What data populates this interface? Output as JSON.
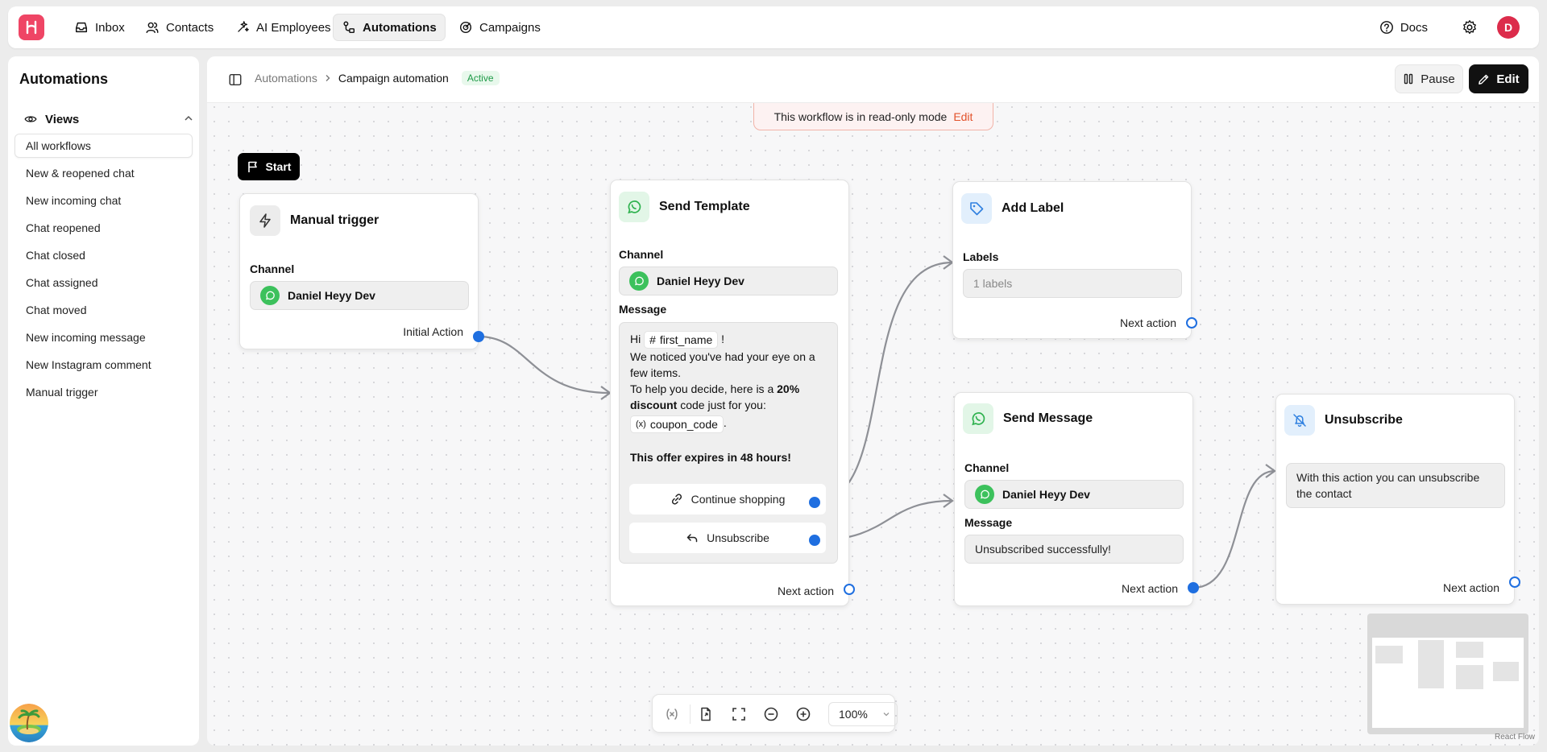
{
  "nav": {
    "items": [
      {
        "label": "Inbox",
        "icon": "inbox-icon"
      },
      {
        "label": "Contacts",
        "icon": "contacts-icon"
      },
      {
        "label": "AI Employees",
        "icon": "sparkle-icon"
      },
      {
        "label": "Automations",
        "icon": "automations-icon",
        "active": true
      },
      {
        "label": "Campaigns",
        "icon": "campaigns-icon"
      }
    ],
    "docs_label": "Docs",
    "avatar_initial": "D"
  },
  "sidebar": {
    "title": "Automations",
    "views_label": "Views",
    "items": [
      {
        "label": "All workflows",
        "active": true
      },
      {
        "label": "New & reopened chat"
      },
      {
        "label": "New incoming chat"
      },
      {
        "label": "Chat reopened"
      },
      {
        "label": "Chat closed"
      },
      {
        "label": "Chat assigned"
      },
      {
        "label": "Chat moved"
      },
      {
        "label": "New incoming message"
      },
      {
        "label": "New Instagram comment"
      },
      {
        "label": "Manual trigger"
      }
    ]
  },
  "header": {
    "breadcrumb_root": "Automations",
    "breadcrumb_current": "Campaign automation",
    "status": "Active",
    "pause_label": "Pause",
    "edit_label": "Edit"
  },
  "banner": {
    "text": "This workflow is in read-only mode",
    "link": "Edit"
  },
  "canvas": {
    "start_label": "Start",
    "trigger": {
      "title": "Manual trigger",
      "channel_label": "Channel",
      "channel_value": "Daniel Heyy Dev",
      "port_label": "Initial Action"
    },
    "send_template": {
      "title": "Send Template",
      "channel_label": "Channel",
      "channel_value": "Daniel Heyy Dev",
      "message_label": "Message",
      "msg_hi": "Hi",
      "msg_var1": "first_name",
      "msg_excl": "!",
      "msg_line2": "We noticed you've had your eye on a few items.",
      "msg_line3_pre": "To help you decide, here is a",
      "msg_line3_bold": "20% discount",
      "msg_line3_post": "code just for you:",
      "msg_var2": "coupon_code",
      "msg_period": ".",
      "msg_offer": "This offer expires in 48 hours!",
      "button1": "Continue shopping",
      "button2": "Unsubscribe",
      "port_label": "Next action"
    },
    "add_label": {
      "title": "Add Label",
      "labels_label": "Labels",
      "labels_placeholder": "1 labels",
      "port_label": "Next action"
    },
    "send_message": {
      "title": "Send Message",
      "channel_label": "Channel",
      "channel_value": "Daniel Heyy Dev",
      "message_label": "Message",
      "message_value": "Unsubscribed successfully!",
      "port_label": "Next action"
    },
    "unsubscribe": {
      "title": "Unsubscribe",
      "description": "With this action you can unsubscribe the contact",
      "port_label": "Next action"
    }
  },
  "toolbar": {
    "zoom": "100%"
  },
  "attribution": "React Flow"
}
